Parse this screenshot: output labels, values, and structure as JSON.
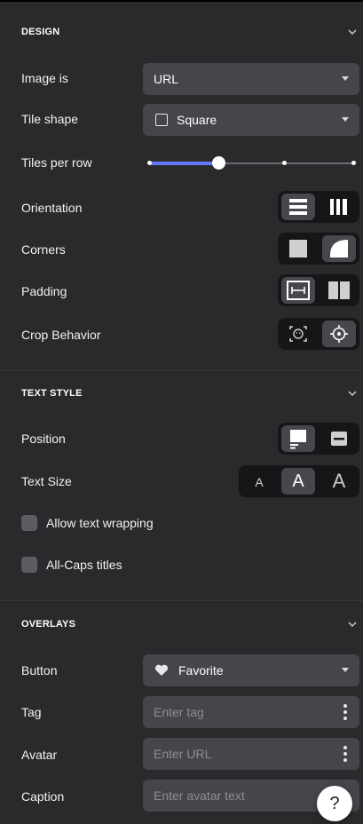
{
  "design": {
    "title": "DESIGN",
    "image_is": {
      "label": "Image is",
      "value": "URL"
    },
    "tile_shape": {
      "label": "Tile shape",
      "value": "Square"
    },
    "tiles_per_row": {
      "label": "Tiles per row",
      "level": 0.34
    },
    "orientation": {
      "label": "Orientation",
      "options": [
        "rows-icon",
        "columns-icon"
      ],
      "selected": 0
    },
    "corners": {
      "label": "Corners",
      "options": [
        "square-corners-icon",
        "rounded-corners-icon"
      ],
      "selected": 1
    },
    "padding": {
      "label": "Padding",
      "options": [
        "padding-horizontal-icon",
        "padding-none-icon"
      ],
      "selected": 0
    },
    "crop_behavior": {
      "label": "Crop Behavior",
      "options": [
        "face-crop-icon",
        "center-target-icon"
      ],
      "selected": 1
    }
  },
  "text_style": {
    "title": "TEXT STYLE",
    "position": {
      "label": "Position",
      "options": [
        "text-below-icon",
        "text-overlay-icon"
      ],
      "selected": 0
    },
    "text_size": {
      "label": "Text Size",
      "options": [
        "A",
        "A",
        "A"
      ],
      "selected": 1
    },
    "allow_wrapping": {
      "label": "Allow text wrapping",
      "checked": false
    },
    "all_caps": {
      "label": "All-Caps titles",
      "checked": false
    }
  },
  "overlays": {
    "title": "OVERLAYS",
    "button": {
      "label": "Button",
      "value": "Favorite",
      "icon": "heart-icon"
    },
    "tag": {
      "label": "Tag",
      "placeholder": "Enter tag"
    },
    "avatar": {
      "label": "Avatar",
      "placeholder": "Enter URL"
    },
    "caption": {
      "label": "Caption",
      "placeholder": "Enter avatar text"
    }
  },
  "help": {
    "label": "?"
  },
  "colors": {
    "panel_bg": "#2a2a2d",
    "control_bg": "#45454b",
    "segment_bg": "#161618",
    "segment_active": "#47474d",
    "accent": "#6576ff"
  }
}
